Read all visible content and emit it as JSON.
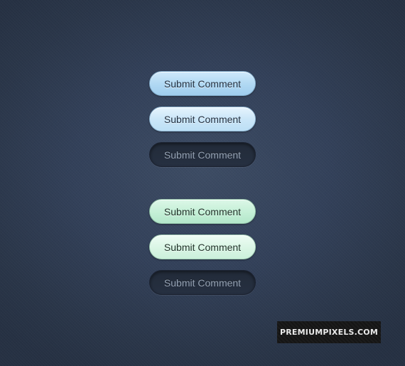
{
  "buttons": {
    "blue_normal": {
      "label": "Submit Comment",
      "state": "normal"
    },
    "blue_hover": {
      "label": "Submit Comment",
      "state": "hover"
    },
    "blue_active": {
      "label": "Submit Comment",
      "state": "active"
    },
    "green_normal": {
      "label": "Submit Comment",
      "state": "normal"
    },
    "green_hover": {
      "label": "Submit Comment",
      "state": "hover"
    },
    "green_active": {
      "label": "Submit Comment",
      "state": "active"
    }
  },
  "watermark": {
    "text": "PREMIUMPIXELS.COM"
  },
  "colors": {
    "background": "#33415a",
    "blue_button": "#b2d9f3",
    "green_button": "#c6f0d8",
    "dark_button": "#232c3a",
    "watermark_bg": "#1a1a1a"
  }
}
